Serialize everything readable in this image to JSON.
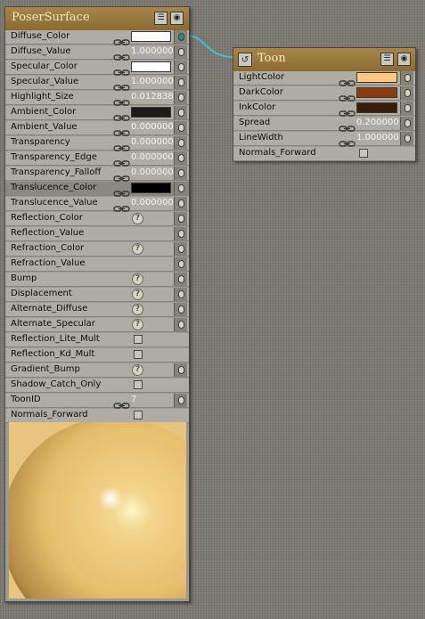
{
  "poser_node": {
    "title": "PoserSurface",
    "rows": [
      {
        "label": "Diffuse_Color",
        "kind": "color",
        "color": "#ffffff",
        "linked": true,
        "plug": true,
        "connected": true
      },
      {
        "label": "Diffuse_Value",
        "kind": "number",
        "value": "1.000000",
        "linked": true,
        "plug": true
      },
      {
        "label": "Specular_Color",
        "kind": "color",
        "color": "#ffffff",
        "linked": true,
        "plug": true
      },
      {
        "label": "Specular_Value",
        "kind": "number",
        "value": "1.000000",
        "linked": true,
        "plug": true
      },
      {
        "label": "Highlight_Size",
        "kind": "number",
        "value": "0.012838",
        "linked": true,
        "plug": true
      },
      {
        "label": "Ambient_Color",
        "kind": "color",
        "color": "#1c1b18",
        "linked": true,
        "plug": true
      },
      {
        "label": "Ambient_Value",
        "kind": "number",
        "value": "0.000000",
        "linked": true,
        "plug": true
      },
      {
        "label": "Transparency",
        "kind": "number",
        "value": "0.000000",
        "linked": true,
        "plug": true
      },
      {
        "label": "Transparency_Edge",
        "kind": "number",
        "value": "0.000000",
        "linked": true,
        "plug": true
      },
      {
        "label": "Transparency_Falloff",
        "kind": "number",
        "value": "0.000000",
        "linked": true,
        "plug": true
      },
      {
        "label": "Translucence_Color",
        "kind": "color",
        "color": "#000000",
        "linked": true,
        "plug": true,
        "highlight": true
      },
      {
        "label": "Translucence_Value",
        "kind": "number",
        "value": "0.000000",
        "linked": true,
        "plug": true
      },
      {
        "label": "Reflection_Color",
        "kind": "help",
        "plug": true
      },
      {
        "label": "Reflection_Value",
        "kind": "blank",
        "plug": true
      },
      {
        "label": "Refraction_Color",
        "kind": "help",
        "plug": true
      },
      {
        "label": "Refraction_Value",
        "kind": "blank",
        "plug": true
      },
      {
        "label": "Bump",
        "kind": "help",
        "plug": true
      },
      {
        "label": "Displacement",
        "kind": "help",
        "plug": true
      },
      {
        "label": "Alternate_Diffuse",
        "kind": "help",
        "plug": true
      },
      {
        "label": "Alternate_Specular",
        "kind": "help",
        "plug": true
      },
      {
        "label": "Reflection_Lite_Mult",
        "kind": "check",
        "plug": false
      },
      {
        "label": "Reflection_Kd_Mult",
        "kind": "check",
        "plug": false
      },
      {
        "label": "Gradient_Bump",
        "kind": "help",
        "plug": true
      },
      {
        "label": "Shadow_Catch_Only",
        "kind": "check",
        "plug": false
      },
      {
        "label": "ToonID",
        "kind": "number",
        "value": "7",
        "linked": true,
        "plug": true
      },
      {
        "label": "Normals_Forward",
        "kind": "check",
        "plug": false
      }
    ]
  },
  "toon_node": {
    "title": "Toon",
    "rows": [
      {
        "label": "LightColor",
        "kind": "color",
        "color": "#ffc680",
        "linked": true,
        "plug": true
      },
      {
        "label": "DarkColor",
        "kind": "color",
        "color": "#8a3a0c",
        "linked": true,
        "plug": true
      },
      {
        "label": "InkColor",
        "kind": "color",
        "color": "#3a1c0a",
        "linked": true,
        "plug": true
      },
      {
        "label": "Spread",
        "kind": "number",
        "value": "0.200000",
        "linked": true,
        "plug": true
      },
      {
        "label": "LineWidth",
        "kind": "number",
        "value": "1.000000",
        "linked": true,
        "plug": true
      },
      {
        "label": "Normals_Forward",
        "kind": "check",
        "plug": false
      }
    ]
  },
  "icons": {
    "help_glyph": "?",
    "menu_glyph": "☰",
    "eye_glyph": "◉",
    "toon_glyph": "↺"
  },
  "colors": {
    "wire": "#3fbfd0",
    "title_gradient_top": "#a8864a"
  }
}
